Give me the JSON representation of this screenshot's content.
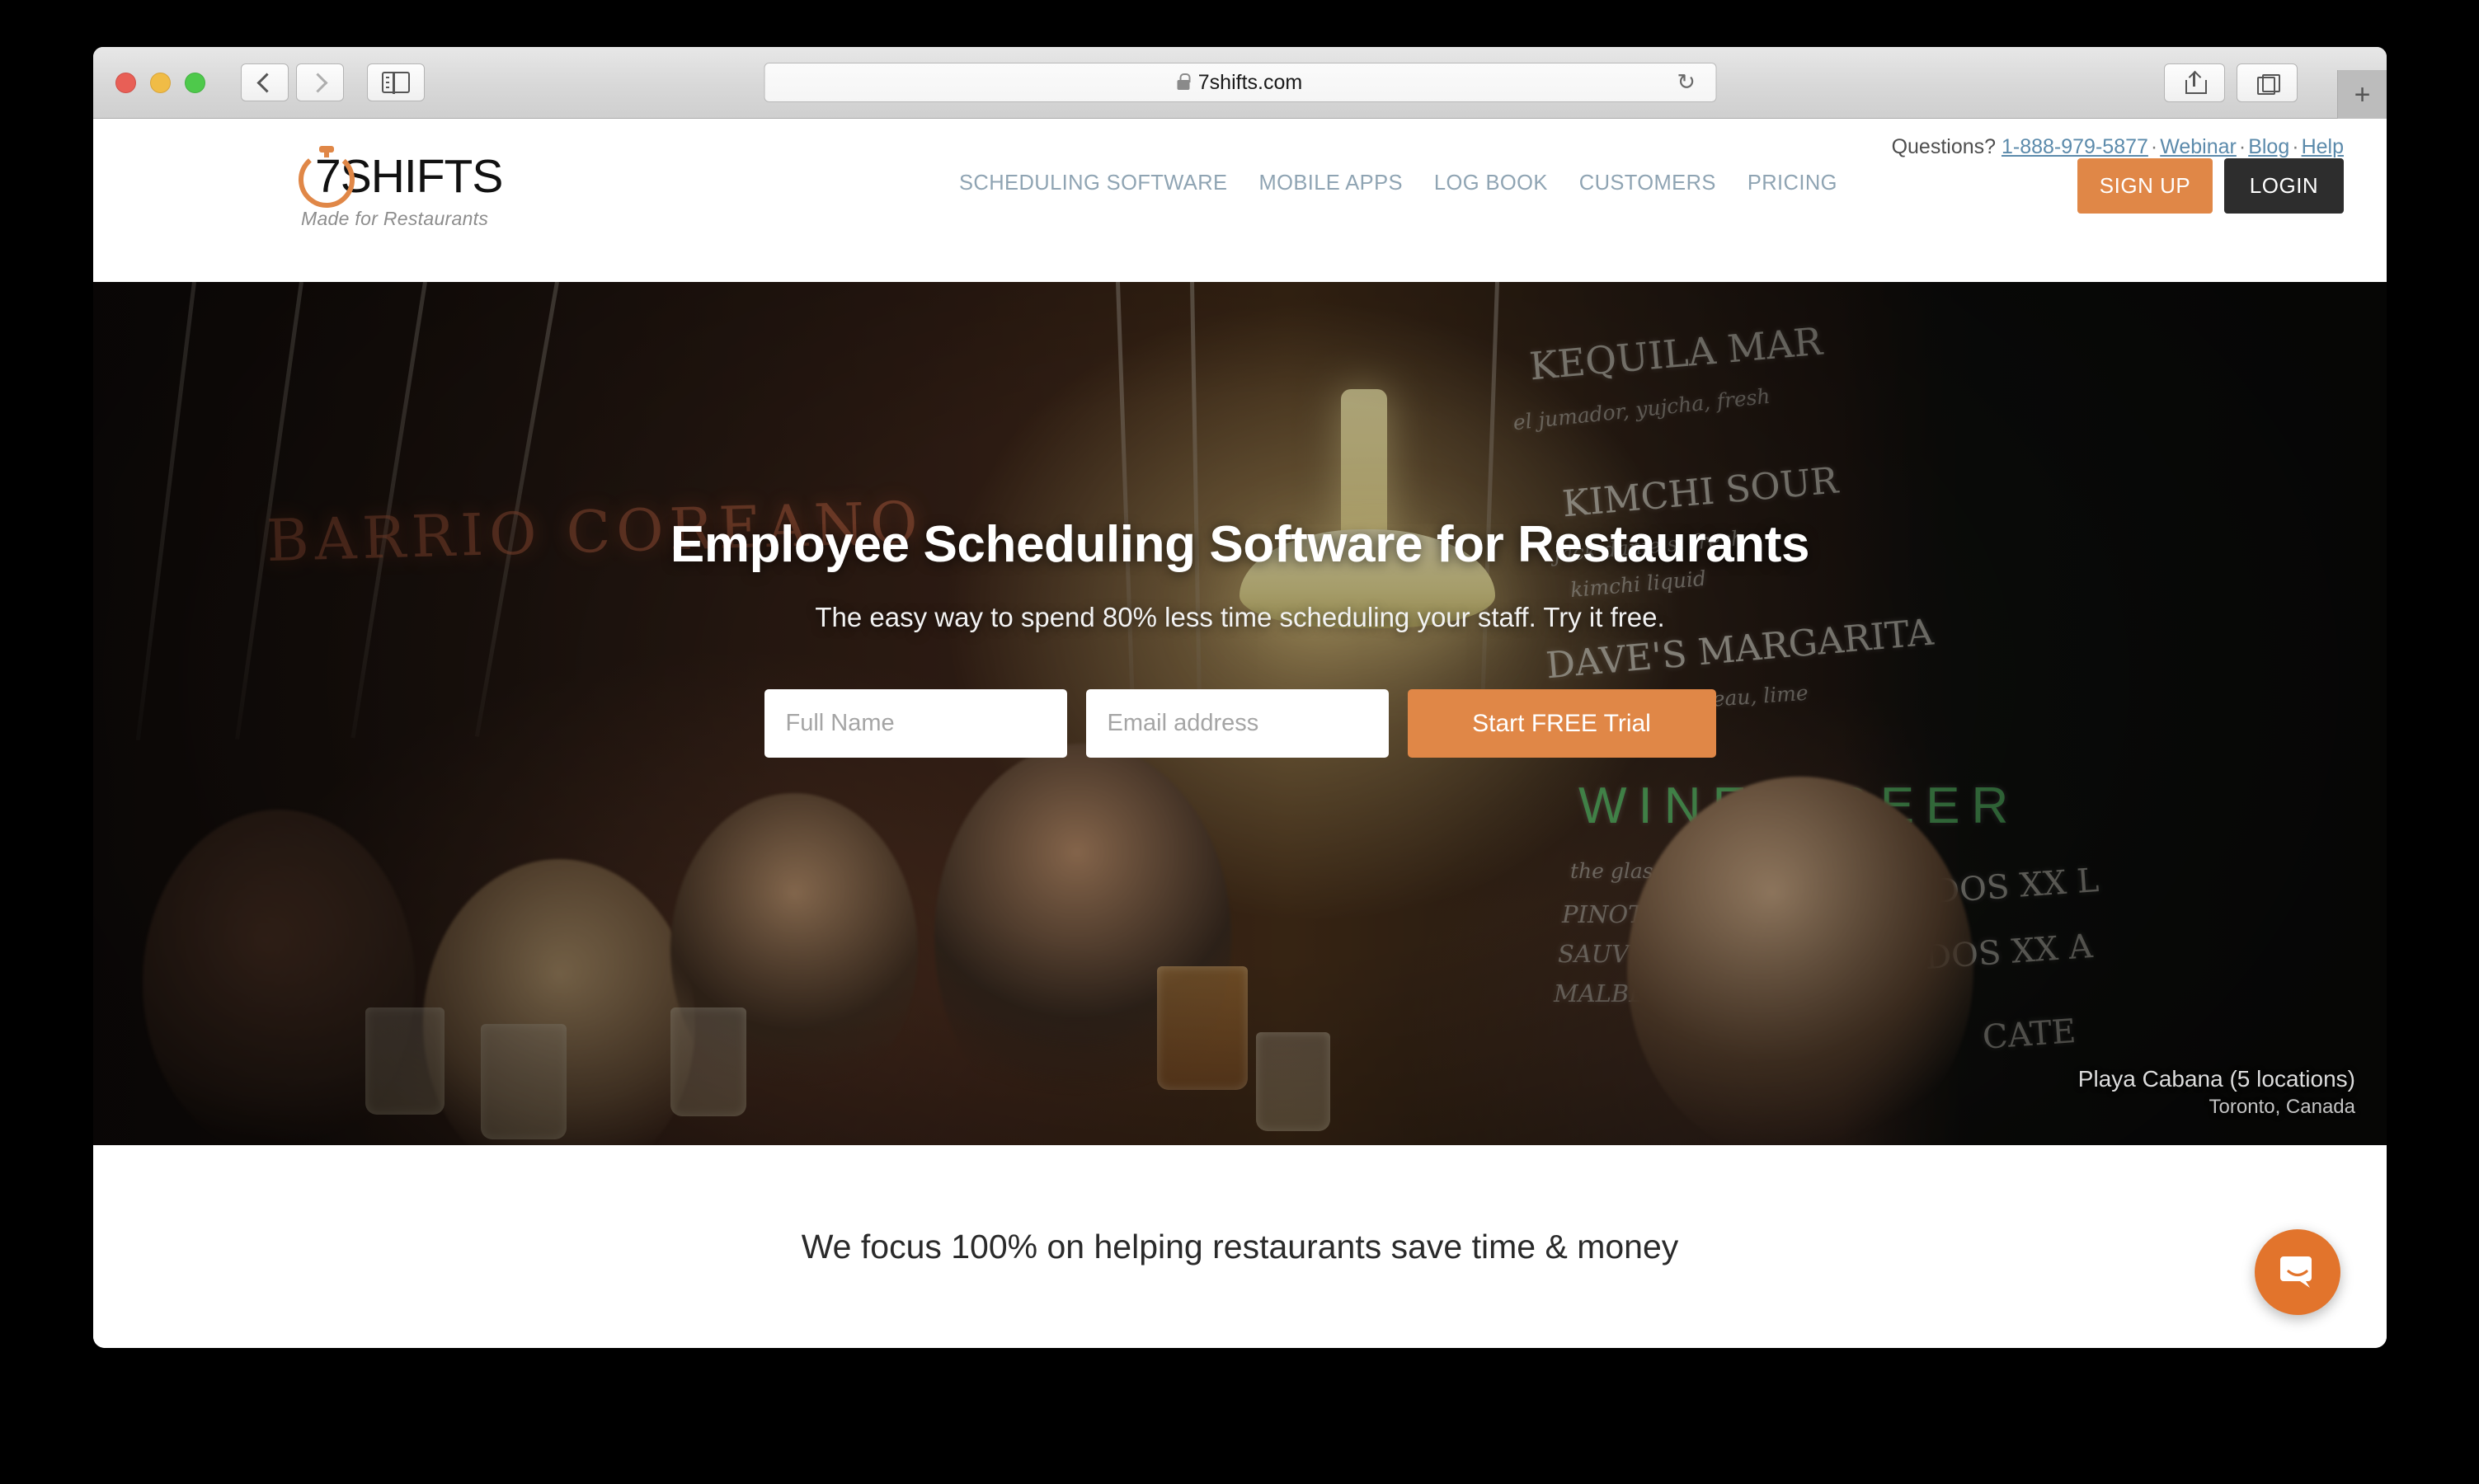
{
  "browser": {
    "url": "7shifts.com",
    "lock_icon": "lock-icon",
    "reload_glyph": "↻",
    "new_tab_glyph": "+",
    "back_icon": "chevron-left-icon",
    "forward_icon": "chevron-right-icon",
    "sidebar_icon": "sidebar-icon",
    "share_icon": "share-icon",
    "tabs_icon": "tab-overview-icon"
  },
  "site": {
    "utility": {
      "questions_label": "Questions?",
      "phone": "1-888-979-5877",
      "webinar": "Webinar",
      "blog": "Blog",
      "help": "Help",
      "separator": "·"
    },
    "logo": {
      "seven": "7",
      "wordmark": "SHIFTS",
      "tagline": "Made for Restaurants"
    },
    "nav": [
      {
        "label": "SCHEDULING SOFTWARE"
      },
      {
        "label": "MOBILE APPS"
      },
      {
        "label": "LOG BOOK"
      },
      {
        "label": "CUSTOMERS"
      },
      {
        "label": "PRICING"
      }
    ],
    "cta": {
      "signup": "SIGN UP",
      "login": "LOGIN",
      "signup_color": "#e08747",
      "login_color": "#2d2d2d"
    }
  },
  "hero": {
    "title": "Employee Scheduling Software for Restaurants",
    "subtitle": "The easy way to spend 80% less time scheduling your staff. Try it free.",
    "form": {
      "name_placeholder": "Full Name",
      "email_placeholder": "Email address",
      "submit_label": "Start FREE Trial"
    },
    "credit": {
      "name": "Playa Cabana (5 locations)",
      "location": "Toronto, Canada"
    },
    "photo": {
      "neon_sign": "BARRIO COREANO",
      "chalkboard": [
        "KEQUILA MAR",
        "el jumador, yujcha, fresh",
        "KIMCHI SOUR",
        "jack daniels, fresh",
        "kimchi liquid",
        "DAVE'S MARGARITA",
        "tromba, cointreau, lime"
      ],
      "chalkboard_green": "WINE | BEER",
      "wine_list": [
        "the glass",
        "PINOT GRIGIO",
        "SAUV BLANC",
        "MALBEC"
      ],
      "beer_list": [
        "DOS XX L",
        "DOS XX A",
        "CATE"
      ]
    }
  },
  "focus": {
    "headline": "We focus 100% on helping restaurants save time & money"
  },
  "chat": {
    "launcher_icon": "chat-bubble-icon",
    "color": "#e2742c"
  }
}
